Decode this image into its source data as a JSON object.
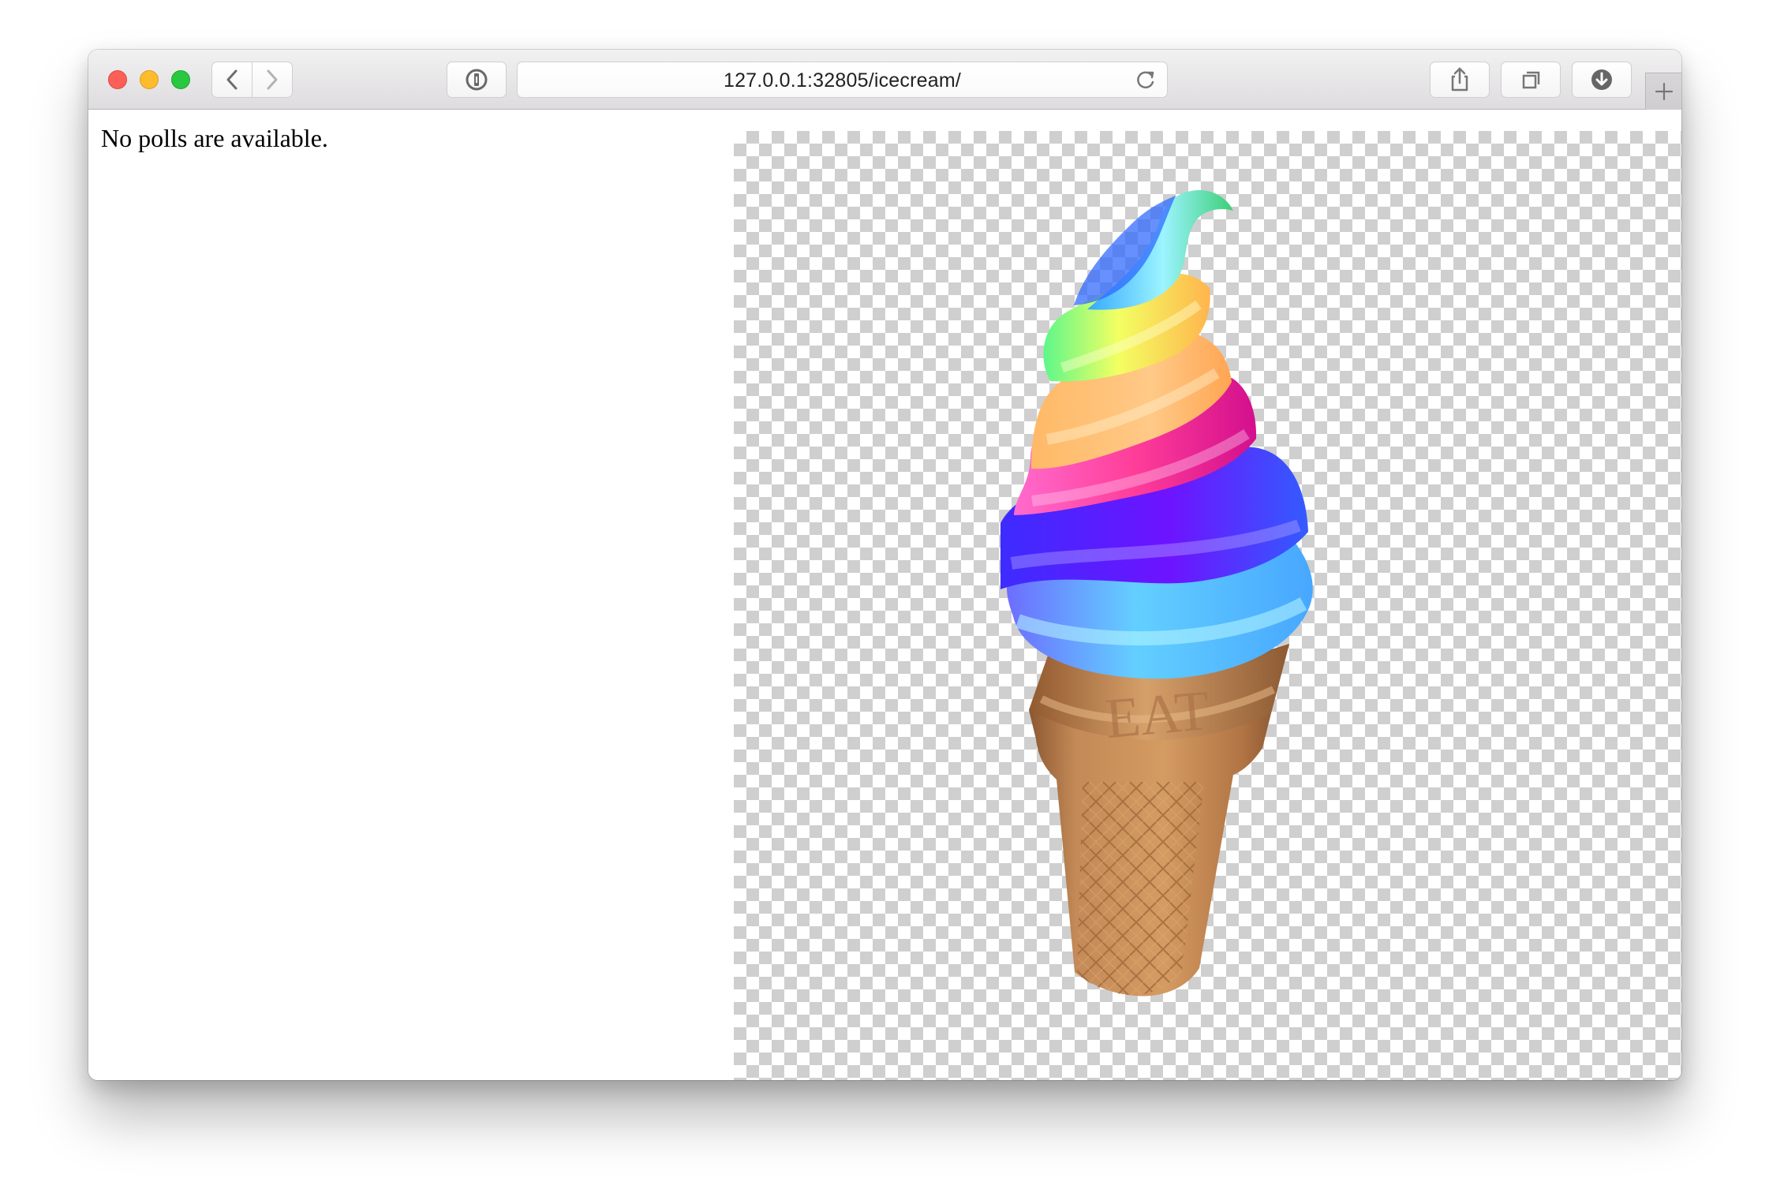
{
  "browser": {
    "address": "127.0.0.1:32805/icecream/",
    "icons": {
      "close": "close-window-control",
      "minimize": "minimize-window-control",
      "zoom": "zoom-window-control",
      "back": "chevron-left-icon",
      "forward": "chevron-right-icon",
      "password": "password-key-icon",
      "reload": "reload-icon",
      "share": "share-icon",
      "tabs": "tabs-icon",
      "downloads": "download-icon",
      "new_tab": "plus-icon"
    }
  },
  "page": {
    "message": "No polls are available.",
    "image": {
      "cone_text": "EAT"
    }
  },
  "colors": {
    "window_close": "#fc5f57",
    "window_minimize": "#fdbc2e",
    "window_zoom": "#28c841",
    "checker_light": "#ffffff",
    "checker_dark": "#cfcfcf",
    "cone": "#c18a54"
  }
}
